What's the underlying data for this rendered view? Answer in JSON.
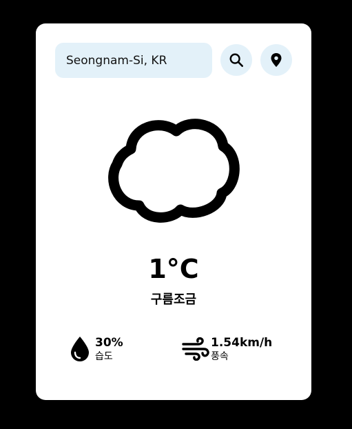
{
  "search": {
    "value": "Seongnam-Si, KR"
  },
  "icons": {
    "search": "search-icon",
    "location": "location-pin-icon",
    "weather": "cloud-icon",
    "humidity": "water-drop-icon",
    "wind": "wind-icon"
  },
  "weather": {
    "temperature": "1°C",
    "description": "구름조금"
  },
  "humidity": {
    "value": "30%",
    "label": "습도"
  },
  "wind": {
    "value": "1.54km/h",
    "label": "풍속"
  },
  "colors": {
    "background": "#000000",
    "card": "#ffffff",
    "accent_bg": "#e3f1f9",
    "text": "#000000"
  }
}
